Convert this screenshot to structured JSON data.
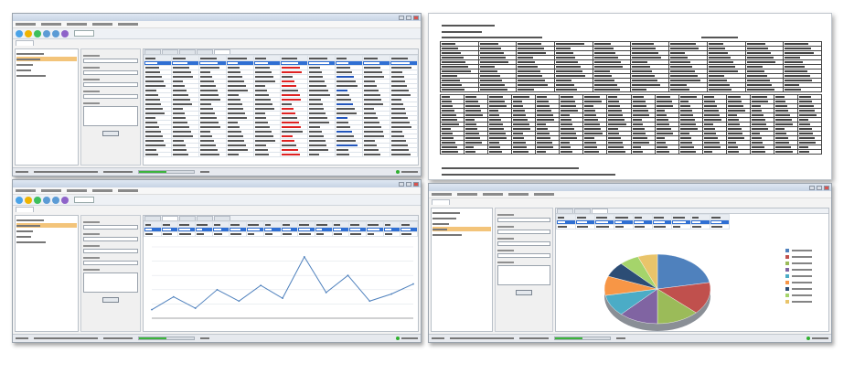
{
  "window_a": {
    "title": "",
    "menu": [
      "",
      "",
      "",
      "",
      ""
    ],
    "toolbar_buttons": [
      {
        "icon": "refresh-icon",
        "color": "#4aa3e8"
      },
      {
        "icon": "sync-icon",
        "color": "#f0b400"
      },
      {
        "icon": "chart-icon",
        "color": "#3dbf5d"
      },
      {
        "icon": "report-icon",
        "color": "#5b9bd5"
      },
      {
        "icon": "save-icon",
        "color": "#5b9bd5"
      },
      {
        "icon": "settings-icon",
        "color": "#8e63c9"
      }
    ],
    "status": {
      "progress": 0.5
    }
  },
  "window_b": {
    "title": "",
    "status": {
      "progress": 0.5
    }
  },
  "window_d": {
    "title": "",
    "status": {
      "progress": 0.5
    }
  },
  "document": {
    "title": "",
    "signature_line": ""
  },
  "chart_data": [
    {
      "type": "line",
      "title": "",
      "xlabel": "",
      "ylabel": "",
      "x": [
        1,
        2,
        3,
        4,
        5,
        6,
        7,
        8,
        9,
        10,
        11,
        12,
        13
      ],
      "series": [
        {
          "values": [
            12,
            30,
            14,
            40,
            24,
            46,
            28,
            86,
            36,
            60,
            24,
            34,
            48
          ]
        }
      ],
      "ylim": [
        0,
        100
      ],
      "grid": true
    },
    {
      "type": "pie",
      "title": "",
      "values": [
        22,
        15,
        13,
        12,
        10,
        9,
        7,
        6,
        6
      ],
      "colors": [
        "#4f81bd",
        "#c0504d",
        "#9bbb59",
        "#8064a2",
        "#4bacc6",
        "#f79646",
        "#2c4d75",
        "#a5d46b",
        "#e9c46a"
      ],
      "legend": "right"
    }
  ]
}
